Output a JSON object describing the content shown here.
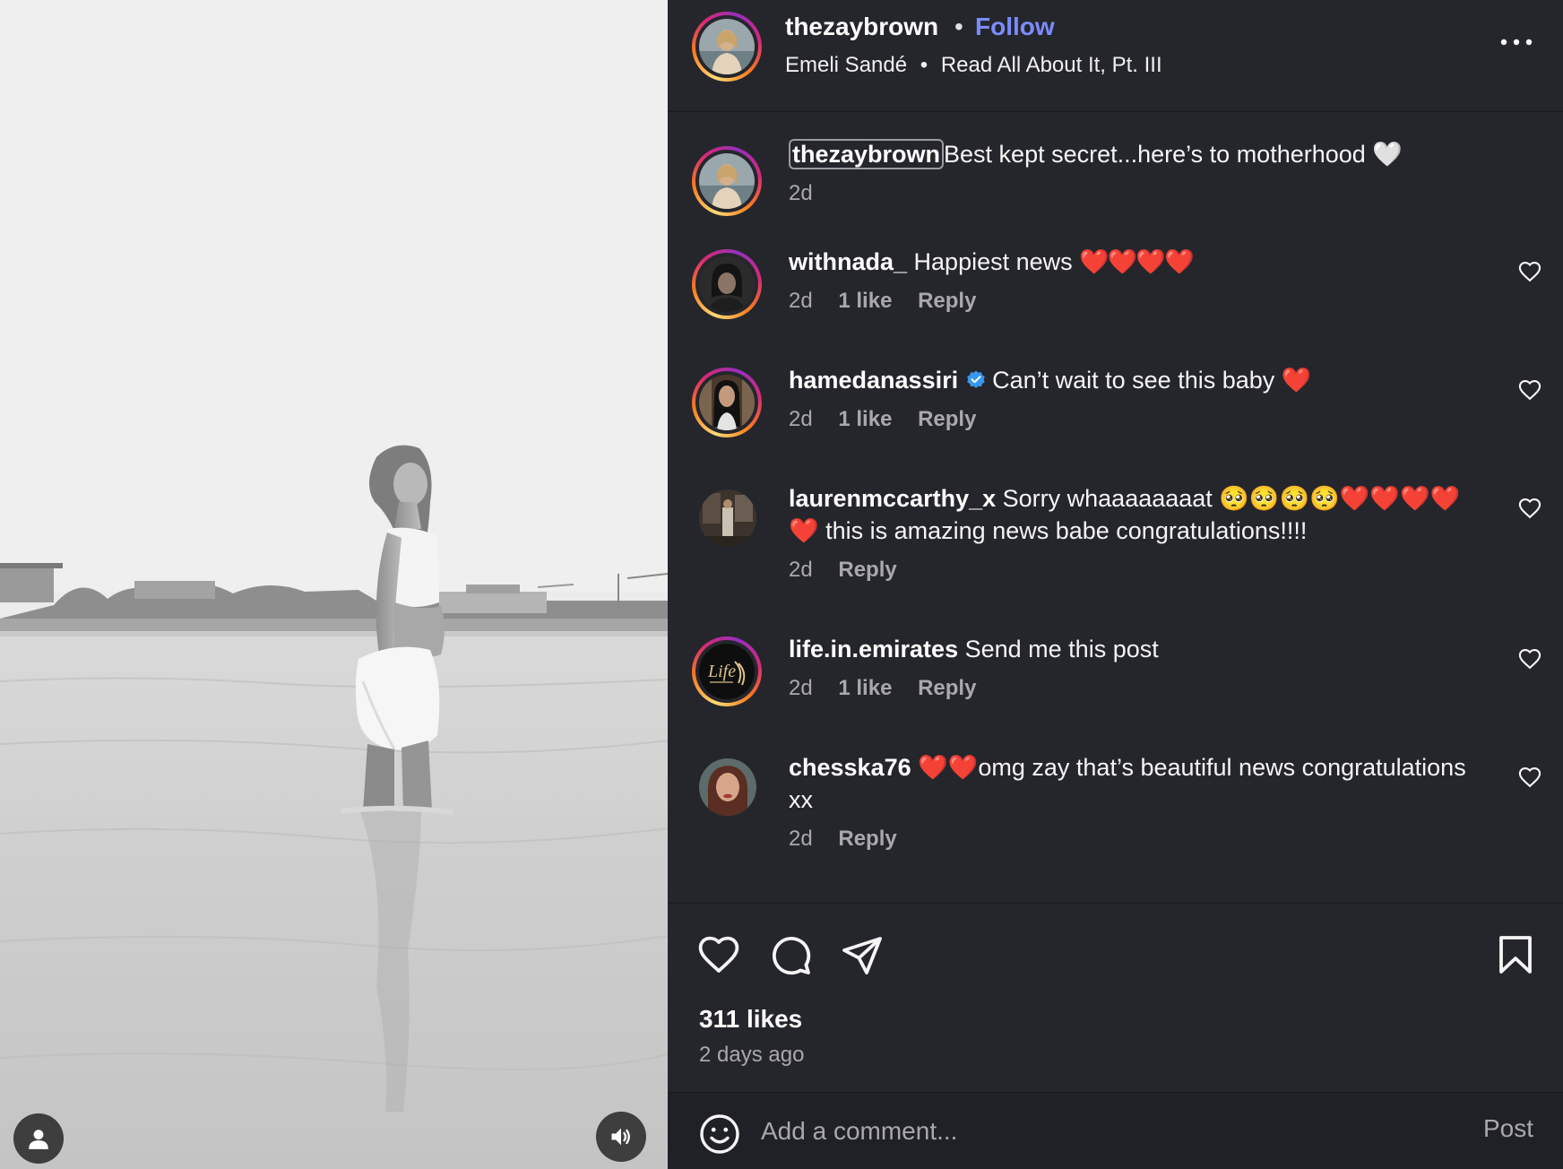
{
  "post": {
    "username": "thezaybrown",
    "separator": "•",
    "follow_label": "Follow",
    "audio_artist": "Emeli Sandé",
    "audio_title": "Read All About It, Pt. III",
    "audio_separator": "•",
    "more_icon": "more-horizontal-icon"
  },
  "caption": {
    "username": "thezaybrown",
    "text": "Best kept secret...here’s to motherhood 🤍",
    "time": "2d"
  },
  "comments": [
    {
      "username": "withnada_",
      "text": "Happiest news ",
      "emoji": "❤️❤️❤️❤️",
      "time": "2d",
      "likes": "1 like",
      "reply": "Reply",
      "verified": false
    },
    {
      "username": "hamedanassiri",
      "text": "Can’t wait to see this baby ",
      "emoji": "❤️",
      "time": "2d",
      "likes": "1 like",
      "reply": "Reply",
      "verified": true
    },
    {
      "username": "laurenmccarthy_x",
      "text": "Sorry whaaaaaaaat 🥺🥺🥺🥺❤️❤️❤️❤️❤️ this is amazing news babe congratulations!!!!",
      "emoji": "",
      "time": "2d",
      "likes": "",
      "reply": "Reply",
      "verified": false
    },
    {
      "username": "life.in.emirates",
      "text": "Send me this post",
      "emoji": "",
      "time": "2d",
      "likes": "1 like",
      "reply": "Reply",
      "verified": false
    },
    {
      "username": "chesska76",
      "text": "❤️❤️omg zay that’s beautiful news congratulations xx",
      "emoji": "",
      "time": "2d",
      "likes": "",
      "reply": "Reply",
      "verified": false
    }
  ],
  "stats": {
    "likes": "311 likes",
    "posted": "2 days ago"
  },
  "composer": {
    "placeholder": "Add a comment...",
    "post_label": "Post"
  },
  "icons": {
    "like": "heart-icon",
    "comment": "comment-icon",
    "share": "send-icon",
    "save": "bookmark-icon",
    "emoji": "smiley-icon",
    "audio": "speaker-icon",
    "user_tag": "person-icon"
  },
  "colors": {
    "panel_bg": "#25262c",
    "follow": "#7b8cff",
    "verified": "#3897f0",
    "muted_text": "#a8a8ad"
  }
}
